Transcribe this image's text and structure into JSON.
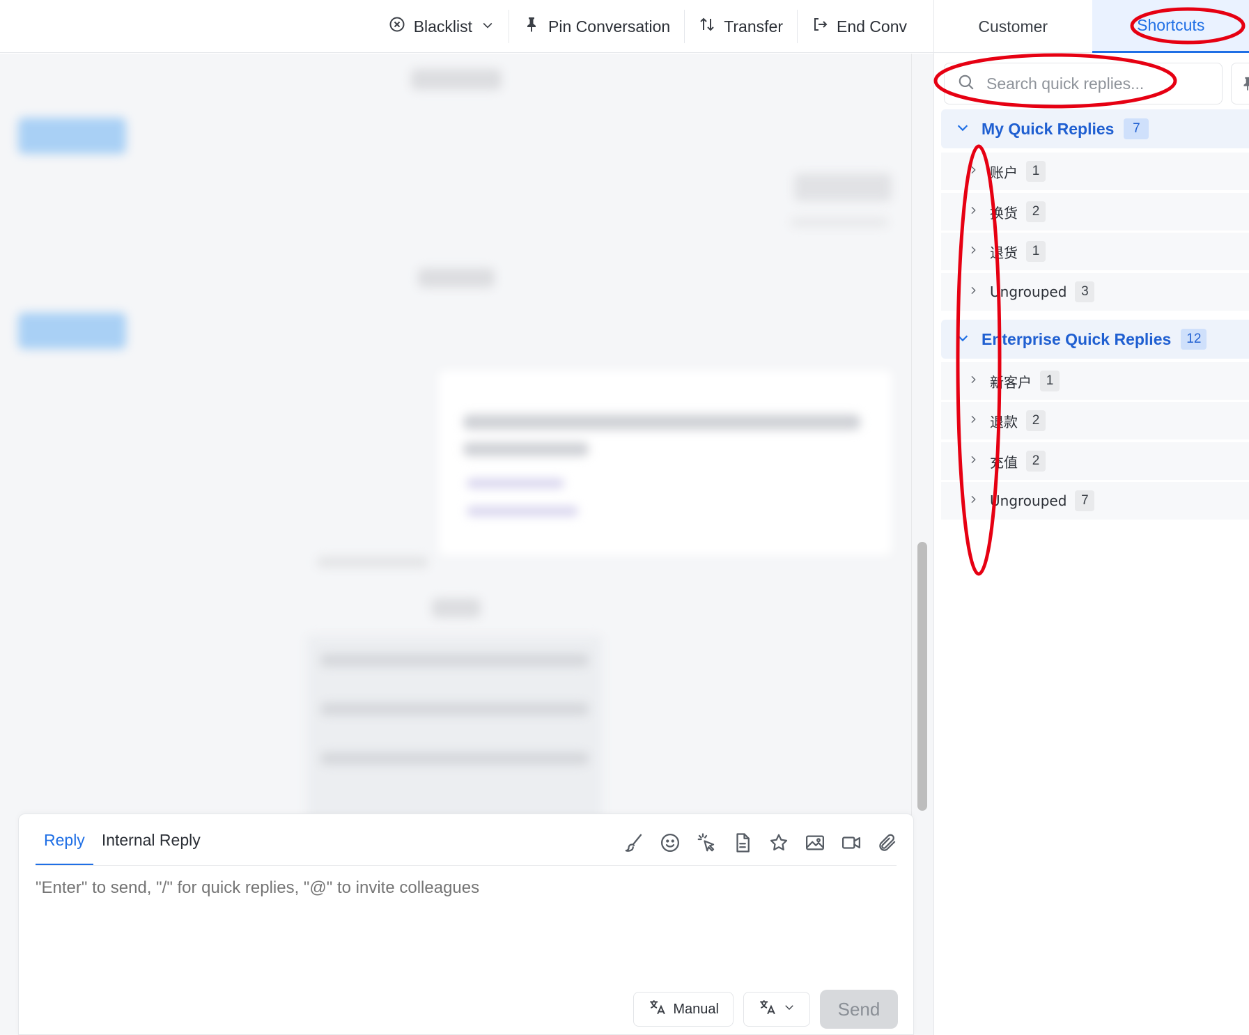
{
  "toolbar": {
    "blacklist": "Blacklist",
    "pin": "Pin Conversation",
    "transfer": "Transfer",
    "end": "End Conv"
  },
  "right_tabs": {
    "customer": "Customer",
    "shortcuts": "Shortcuts"
  },
  "search": {
    "placeholder": "Search quick replies..."
  },
  "groups": [
    {
      "title": "My Quick Replies",
      "count": "7",
      "items": [
        {
          "label": "账户",
          "count": "1"
        },
        {
          "label": "换货",
          "count": "2"
        },
        {
          "label": "退货",
          "count": "1"
        },
        {
          "label": "Ungrouped",
          "count": "3"
        }
      ]
    },
    {
      "title": "Enterprise Quick Replies",
      "count": "12",
      "items": [
        {
          "label": "新客户",
          "count": "1"
        },
        {
          "label": "退款",
          "count": "2"
        },
        {
          "label": "充值",
          "count": "2"
        },
        {
          "label": "Ungrouped",
          "count": "7"
        }
      ]
    }
  ],
  "composer": {
    "tab_reply": "Reply",
    "tab_internal": "Internal Reply",
    "placeholder": "\"Enter\" to send, \"/\" for quick replies, \"@\" to invite colleagues",
    "manual": "Manual",
    "send": "Send"
  },
  "colors": {
    "accent": "#1f6fe5",
    "annotation": "#e60012"
  }
}
